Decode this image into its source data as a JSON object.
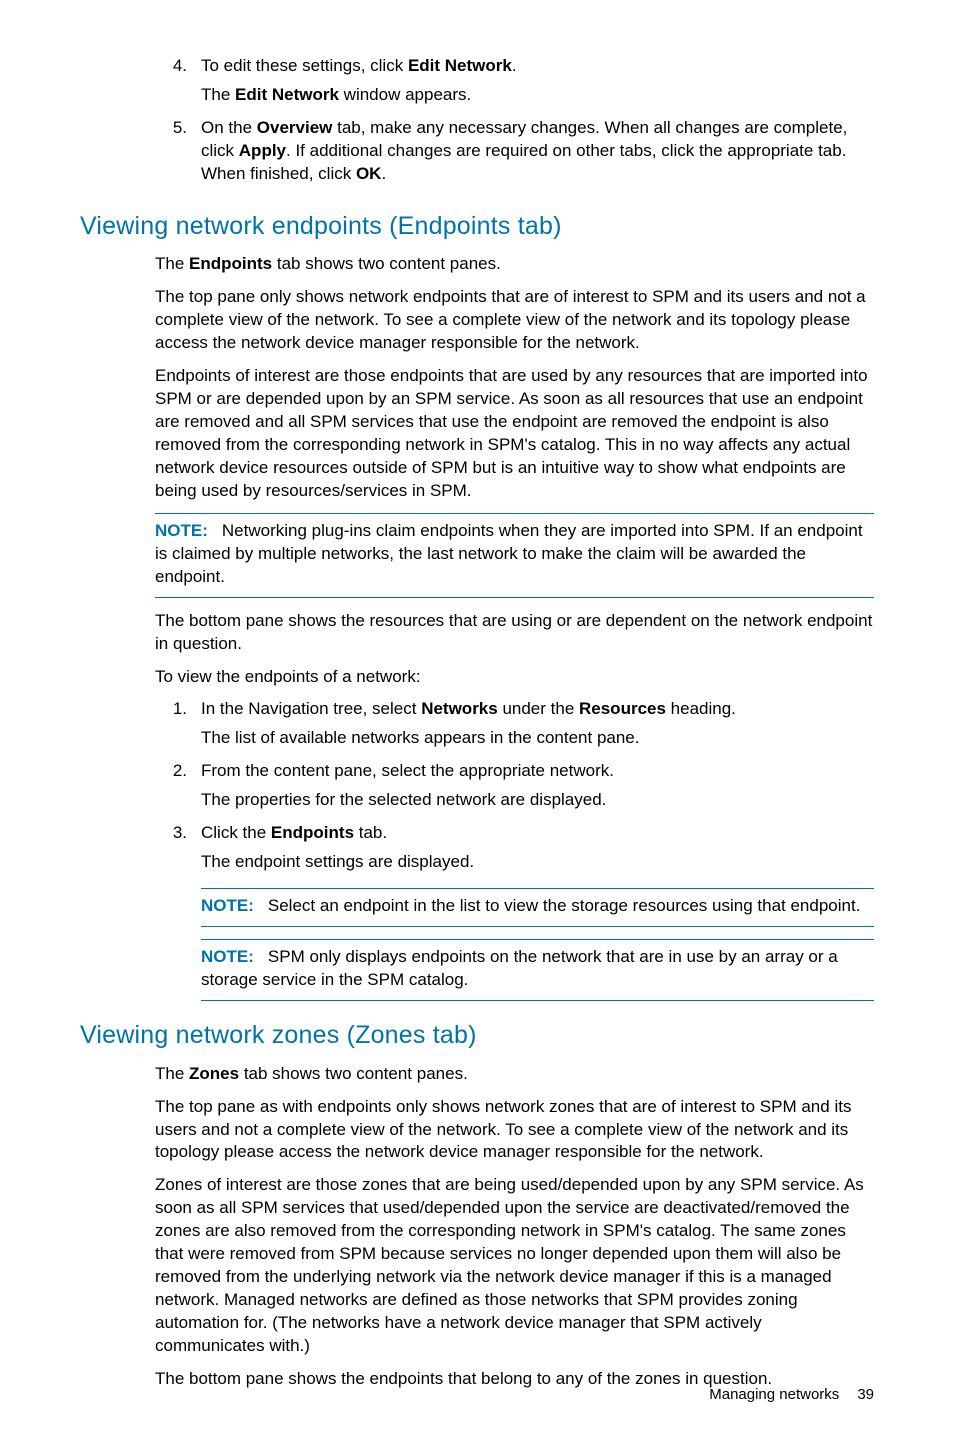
{
  "topList": {
    "items": [
      {
        "num": "4.",
        "line1_a": "To edit these settings, click ",
        "line1_bold": "Edit Network",
        "line1_b": ".",
        "line2_a": "The ",
        "line2_bold": "Edit Network",
        "line2_b": " window appears."
      },
      {
        "num": "5.",
        "line1_a": "On the ",
        "line1_bold1": "Overview",
        "line1_b": " tab, make any necessary changes. When all changes are complete, click ",
        "line1_bold2": "Apply",
        "line1_c": ". If additional changes are required on other tabs, click the appropriate tab. When finished, click ",
        "line1_bold3": "OK",
        "line1_d": "."
      }
    ]
  },
  "section1": {
    "title": "Viewing network endpoints (Endpoints tab)",
    "p1_a": "The ",
    "p1_bold": "Endpoints",
    "p1_b": " tab shows two content panes.",
    "p2": "The top pane only shows network endpoints that are of interest to SPM and its users and not a complete view of the network. To see a complete view of the network and its topology please access the network device manager responsible for the network.",
    "p3": "Endpoints of interest are those endpoints that are used by any resources that are imported into SPM or are depended upon by an SPM service. As soon as all resources that use an endpoint are removed and all SPM services that use the endpoint are removed the endpoint is also removed from the corresponding network in SPM's catalog. This in no way affects any actual network device resources outside of SPM but is an intuitive way to show what endpoints are being used by resources/services in SPM.",
    "note1_label": "NOTE:",
    "note1_text": "Networking plug-ins claim endpoints when they are imported into SPM. If an endpoint is claimed by multiple networks, the last network to make the claim will be awarded the endpoint.",
    "p4": "The bottom pane shows the resources that are using or are dependent on the network endpoint in question.",
    "p5": "To view the endpoints of a network:",
    "steps": [
      {
        "num": "1.",
        "l1_a": "In the Navigation tree, select ",
        "l1_bold1": "Networks",
        "l1_b": " under the ",
        "l1_bold2": "Resources",
        "l1_c": " heading.",
        "l2": "The list of available networks appears in the content pane."
      },
      {
        "num": "2.",
        "l1": "From the content pane, select the appropriate network.",
        "l2": "The properties for the selected network are displayed."
      },
      {
        "num": "3.",
        "l1_a": "Click the ",
        "l1_bold": "Endpoints",
        "l1_b": " tab.",
        "l2": "The endpoint settings are displayed."
      }
    ],
    "note2_label": "NOTE:",
    "note2_text": "Select an endpoint in the list to view the storage resources using that endpoint.",
    "note3_label": "NOTE:",
    "note3_text": "SPM only displays endpoints on the network that are in use by an array or a storage service in the SPM catalog."
  },
  "section2": {
    "title": "Viewing network zones (Zones tab)",
    "p1_a": "The ",
    "p1_bold": "Zones",
    "p1_b": " tab shows two content panes.",
    "p2": "The top pane as with endpoints only shows network zones that are of interest to SPM and its users and not a complete view of the network. To see a complete view of the network and its topology please access the network device manager responsible for the network.",
    "p3": "Zones of interest are those zones that are being used/depended upon by any SPM service. As soon as all SPM services that used/depended upon the service are deactivated/removed the zones are also removed from the corresponding network in SPM's catalog. The same zones that were removed from SPM because services no longer depended upon them will also be removed from the underlying network via the network device manager if this is a managed network. Managed networks are defined as those networks that SPM provides zoning automation for. (The networks have a network device manager that SPM actively communicates with.)",
    "p4": "The bottom pane shows the endpoints that belong to any of the zones in question."
  },
  "footer": {
    "text": "Managing networks",
    "page": "39"
  }
}
